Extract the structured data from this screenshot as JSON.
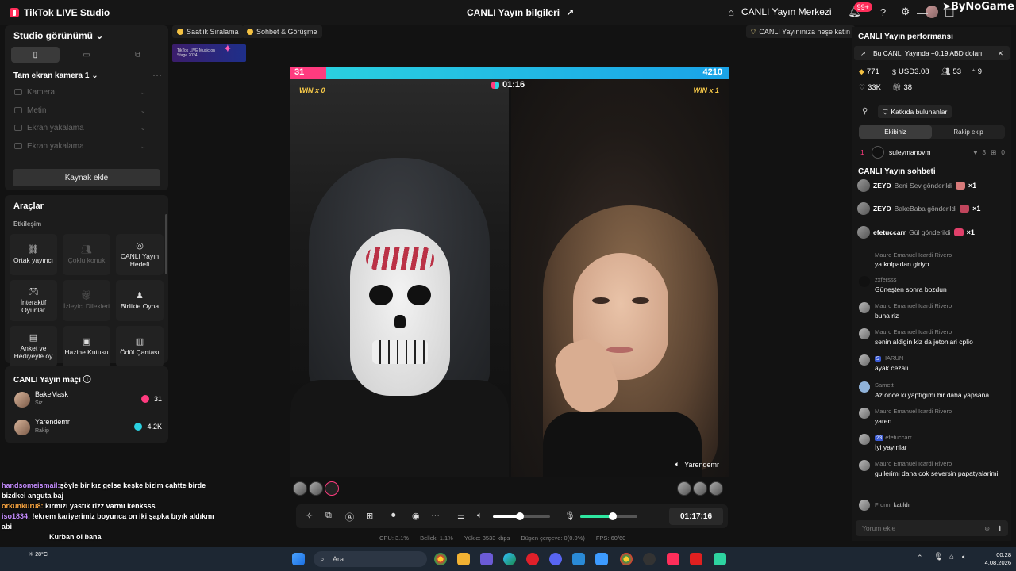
{
  "titlebar": {
    "app_name": "TikTok LIVE Studio",
    "center_title": "CANLI Yayın bilgileri",
    "live_center": "CANLI Yayın Merkezi",
    "notif_count": "99+",
    "watermark": "ByNoGame"
  },
  "left": {
    "studio_view": "Studio görünümü",
    "scene_name": "Tam ekran kamera 1",
    "sources": [
      "Kamera",
      "Metin",
      "Ekran yakalama",
      "Ekran yakalama"
    ],
    "add_source": "Kaynak ekle",
    "tools_title": "Araçlar",
    "tools_section": "Etkileşim",
    "tools": [
      {
        "label": "Ortak yayıncı",
        "icon": "link-icon"
      },
      {
        "label": "Çoklu konuk",
        "icon": "users-icon"
      },
      {
        "label": "CANLI Yayın Hedefi",
        "icon": "target-icon"
      },
      {
        "label": "İnteraktif Oyunlar",
        "icon": "gamepad-icon"
      },
      {
        "label": "İzleyici Dilekleri",
        "icon": "gift-icon"
      },
      {
        "label": "Birlikte Oyna",
        "icon": "play-together-icon"
      },
      {
        "label": "Anket ve Hediyeyle oy",
        "icon": "poll-icon"
      },
      {
        "label": "Hazine Kutusu",
        "icon": "treasure-icon"
      },
      {
        "label": "Ödül Çantası",
        "icon": "bag-icon"
      }
    ],
    "match_title": "CANLI Yayın maçı",
    "match": [
      {
        "name": "BakeMask",
        "sub": "Siz",
        "score": "31",
        "color": "#ff3b7f"
      },
      {
        "name": "Yarendemr",
        "sub": "Rakip",
        "score": "4.2K",
        "color": "#2ad0e0"
      }
    ]
  },
  "overlay_chat": [
    {
      "user": "handsomeismail:",
      "text": "şöyle bir kız gelse keşke bizim cahtte birde bizdkei anguta baj",
      "color": "#c58cff"
    },
    {
      "user": "orkunkuru8:",
      "text": "kırmızı yastık rizz varmı kenksss",
      "color": "#f7a440"
    },
    {
      "user": "iso1834:",
      "text": "!ekrem kariyerimiz boyunca on iki şapka bıyık aldıkmı abi",
      "color": "#c58cff"
    },
    {
      "user": "",
      "text": "Kurban ol bana",
      "color": "#ff4b4b"
    }
  ],
  "center": {
    "toplinks": [
      "Saatlik Sıralama",
      "Sohbet & Görüşme",
      "CANLI Yayınınıza neşe katın"
    ],
    "banner_text": "TikTok LIVE Music on Stage 2024",
    "score_left": "31",
    "score_right": "4210",
    "win_left": "WIN x 0",
    "win_right": "WIN x 1",
    "timer": "01:16",
    "opponent_name": "Yarendemr",
    "duration": "01:17:16",
    "stats": {
      "cpu": "CPU:  3.1%",
      "memory": "Bellek:  1.1%",
      "upload": "Yükle:  3533 kbps",
      "dropped": "Düşen çerçeve:  0(0.0%)",
      "fps": "FPS:  60/60"
    },
    "score_ratio": 0.0073,
    "speaker_level": 0.85,
    "mic_level": 0.75
  },
  "right": {
    "perf_title": "CANLI Yayın performansı",
    "perf_banner": "Bu CANLI Yayında +0.19 ABD doları",
    "metrics": [
      "771",
      "USD3.08",
      "53",
      "9",
      "33K",
      "38"
    ],
    "contributors": "Katkıda bulunanlar",
    "tab_team": "Ekibiniz",
    "tab_rival": "Rakip ekip",
    "rank": {
      "pos": "1",
      "name": "suleymanovm",
      "likes": "3",
      "gifts": "0"
    },
    "chat_title": "CANLI Yayın sohbeti",
    "gifts": [
      {
        "user": "ZEYD",
        "text": "Beni Sev gönderildi",
        "count": "×1",
        "color": "#d87a7a"
      },
      {
        "user": "ZEYD",
        "text": "BakeBaba gönderildi",
        "count": "×1",
        "color": "#c0455c"
      },
      {
        "user": "efetuccarr",
        "text": "Gül gönderildi",
        "count": "×1",
        "color": "#e0406a"
      }
    ],
    "messages": [
      {
        "user": "Mauro Emanuel Icardi Rivero",
        "text": "ya kolpadan giriyo"
      },
      {
        "user": "zxfersss",
        "text": "Güneşten sonra bozdun"
      },
      {
        "user": "Mauro Emanuel Icardi Rivero",
        "text": "buna riz"
      },
      {
        "user": "Mauro Emanuel Icardi Rivero",
        "text": "senin aldigin kiz da jetonlari cplio"
      },
      {
        "user": "HARUN",
        "text": "ayak cezalı",
        "level": "5"
      },
      {
        "user": "Samett",
        "text": "Az önce ki yaptığımı bir daha yapsana"
      },
      {
        "user": "Mauro Emanuel Icardi Rivero",
        "text": "yaren"
      },
      {
        "user": "efetuccarr",
        "text": "İyi yayınlar",
        "level": "23"
      },
      {
        "user": "Mauro Emanuel Icardi Rivero",
        "text": "gullerimi daha cok seversin papatyalarimi"
      },
      {
        "user": "Frqnn",
        "text": "katıldı"
      }
    ],
    "comment_placeholder": "Yorum ekle"
  },
  "taskbar": {
    "search": "Ara",
    "time": "00:28",
    "date": "4.08.2026",
    "weather": "28°C"
  }
}
